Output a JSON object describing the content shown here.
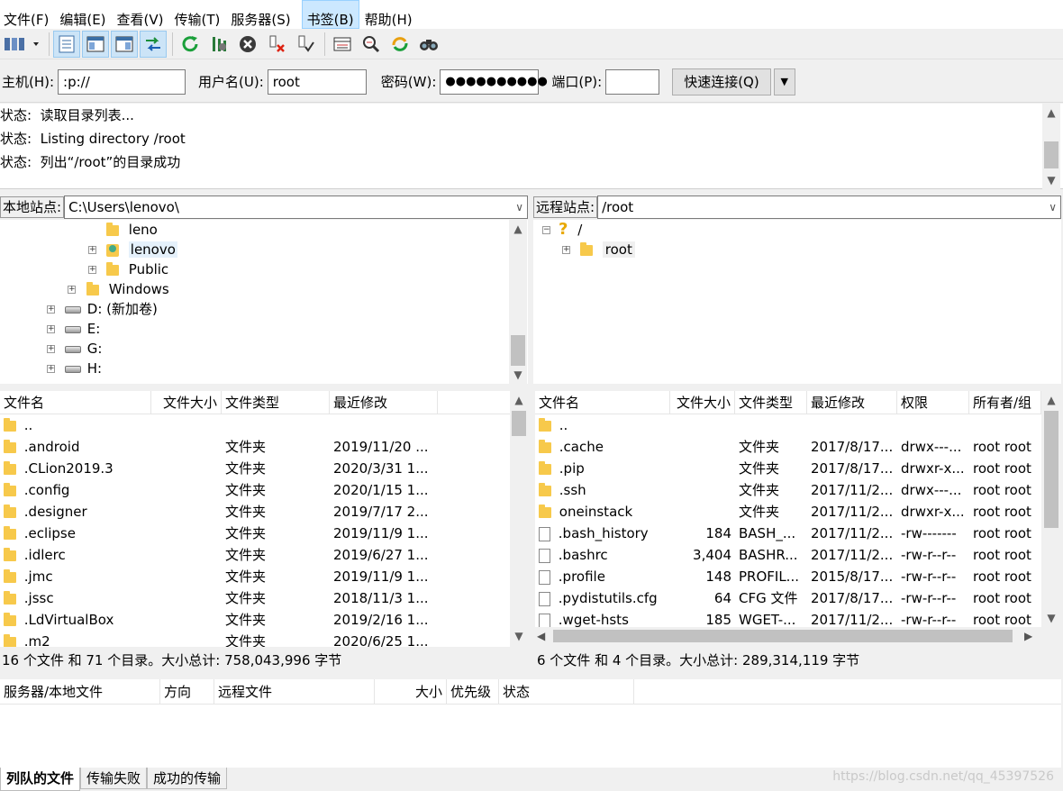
{
  "menu": [
    "文件(F)",
    "编辑(E)",
    "查看(V)",
    "传输(T)",
    "服务器(S)",
    "书签(B)",
    "帮助(H)"
  ],
  "toolbar_icons": [
    "site-manager-icon",
    "message-log-icon",
    "local-tree-icon",
    "remote-tree-icon",
    "transfer-queue-icon",
    "refresh-icon",
    "process-queue-icon",
    "cancel-icon",
    "disconnect-icon",
    "reconnect-icon",
    "filter-icon",
    "compare-icon",
    "sync-browse-icon",
    "search-icon"
  ],
  "quickconnect": {
    "host_label": "主机(H):",
    "host_value": ":p://",
    "user_label": "用户名(U):",
    "user_value": "root",
    "pass_label": "密码(W):",
    "pass_value": "●●●●●●●●●●",
    "port_label": "端口(P):",
    "port_value": "",
    "connect_label": "快速连接(Q)"
  },
  "log": [
    {
      "prefix": "状态:",
      "text": "读取目录列表..."
    },
    {
      "prefix": "状态:",
      "text": "Listing directory /root"
    },
    {
      "prefix": "状态:",
      "text": "列出“/root”的目录成功"
    }
  ],
  "local": {
    "site_label": "本地站点:",
    "path": "C:\\Users\\lenovo\\",
    "tree": [
      {
        "label": "leno",
        "type": "folder",
        "expander": false
      },
      {
        "label": "lenovo",
        "type": "user-folder",
        "expander": true
      },
      {
        "label": "Public",
        "type": "folder",
        "expander": true
      },
      {
        "label": "Windows",
        "type": "folder",
        "expander": true
      },
      {
        "label": "D: (新加卷)",
        "type": "drive",
        "expander": true
      },
      {
        "label": "E:",
        "type": "drive",
        "expander": true
      },
      {
        "label": "G:",
        "type": "drive",
        "expander": true
      },
      {
        "label": "H:",
        "type": "drive",
        "expander": true
      }
    ],
    "columns": [
      "文件名",
      "文件大小",
      "文件类型",
      "最近修改"
    ],
    "files": [
      {
        "name": "..",
        "size": "",
        "type": "",
        "modified": ""
      },
      {
        "name": ".android",
        "size": "",
        "type": "文件夹",
        "modified": "2019/11/20 ..."
      },
      {
        "name": ".CLion2019.3",
        "size": "",
        "type": "文件夹",
        "modified": "2020/3/31 1..."
      },
      {
        "name": ".config",
        "size": "",
        "type": "文件夹",
        "modified": "2020/1/15 1..."
      },
      {
        "name": ".designer",
        "size": "",
        "type": "文件夹",
        "modified": "2019/7/17 2..."
      },
      {
        "name": ".eclipse",
        "size": "",
        "type": "文件夹",
        "modified": "2019/11/9 1..."
      },
      {
        "name": ".idlerc",
        "size": "",
        "type": "文件夹",
        "modified": "2019/6/27 1..."
      },
      {
        "name": ".jmc",
        "size": "",
        "type": "文件夹",
        "modified": "2019/11/9 1..."
      },
      {
        "name": ".jssc",
        "size": "",
        "type": "文件夹",
        "modified": "2018/11/3 1..."
      },
      {
        "name": ".LdVirtualBox",
        "size": "",
        "type": "文件夹",
        "modified": "2019/2/16 1..."
      },
      {
        "name": ".m2",
        "size": "",
        "type": "文件夹",
        "modified": "2020/6/25 1..."
      }
    ],
    "status": "16 个文件 和 71 个目录。大小总计: 758,043,996 字节"
  },
  "remote": {
    "site_label": "远程站点:",
    "path": "/root",
    "tree": [
      {
        "label": "/",
        "type": "unknown"
      },
      {
        "label": "root",
        "type": "folder"
      }
    ],
    "columns": [
      "文件名",
      "文件大小",
      "文件类型",
      "最近修改",
      "权限",
      "所有者/组"
    ],
    "files": [
      {
        "name": "..",
        "size": "",
        "type": "",
        "modified": "",
        "perm": "",
        "owner": "",
        "icon": "folder"
      },
      {
        "name": ".cache",
        "size": "",
        "type": "文件夹",
        "modified": "2017/8/17...",
        "perm": "drwx---...",
        "owner": "root root",
        "icon": "folder"
      },
      {
        "name": ".pip",
        "size": "",
        "type": "文件夹",
        "modified": "2017/8/17...",
        "perm": "drwxr-x...",
        "owner": "root root",
        "icon": "folder"
      },
      {
        "name": ".ssh",
        "size": "",
        "type": "文件夹",
        "modified": "2017/11/2...",
        "perm": "drwx---...",
        "owner": "root root",
        "icon": "folder"
      },
      {
        "name": "oneinstack",
        "size": "",
        "type": "文件夹",
        "modified": "2017/11/2...",
        "perm": "drwxr-x...",
        "owner": "root root",
        "icon": "folder"
      },
      {
        "name": ".bash_history",
        "size": "184",
        "type": "BASH_...",
        "modified": "2017/11/2...",
        "perm": "-rw-------",
        "owner": "root root",
        "icon": "file"
      },
      {
        "name": ".bashrc",
        "size": "3,404",
        "type": "BASHR...",
        "modified": "2017/11/2...",
        "perm": "-rw-r--r--",
        "owner": "root root",
        "icon": "file"
      },
      {
        "name": ".profile",
        "size": "148",
        "type": "PROFIL...",
        "modified": "2015/8/17...",
        "perm": "-rw-r--r--",
        "owner": "root root",
        "icon": "file"
      },
      {
        "name": ".pydistutils.cfg",
        "size": "64",
        "type": "CFG 文件",
        "modified": "2017/8/17...",
        "perm": "-rw-r--r--",
        "owner": "root root",
        "icon": "file"
      },
      {
        "name": ".wget-hsts",
        "size": "185",
        "type": "WGET-...",
        "modified": "2017/11/2...",
        "perm": "-rw-r--r--",
        "owner": "root root",
        "icon": "file"
      }
    ],
    "status": "6 个文件 和 4 个目录。大小总计: 289,314,119 字节"
  },
  "queue": {
    "columns": [
      "服务器/本地文件",
      "方向",
      "远程文件",
      "大小",
      "优先级",
      "状态"
    ],
    "tabs": [
      "列队的文件",
      "传输失败",
      "成功的传输"
    ]
  },
  "watermark": "https://blog.csdn.net/qq_45397526"
}
